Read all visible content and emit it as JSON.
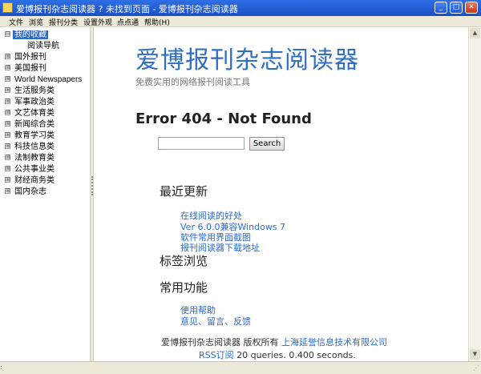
{
  "window": {
    "title": "爱博报刊杂志阅读器 ? 未找到页面 - 爱博报刊杂志阅读器",
    "buttons": {
      "minimize": "_",
      "maximize": "□",
      "close": "✕"
    }
  },
  "menu": [
    "文件",
    "浏览",
    "报刊分类",
    "设置外观",
    "点点通",
    "帮助(H)"
  ],
  "sidebar": {
    "items": [
      {
        "label": "我的收藏",
        "expander": "⊟",
        "selected": true,
        "children": [
          "阅读导航"
        ]
      },
      {
        "label": "国外报刊",
        "expander": "⊞"
      },
      {
        "label": "美国报刊",
        "expander": "⊞"
      },
      {
        "label": "World Newspapers",
        "expander": "⊞"
      },
      {
        "label": "生活服务类",
        "expander": "⊞"
      },
      {
        "label": "军事政治类",
        "expander": "⊞"
      },
      {
        "label": "文艺体育类",
        "expander": "⊞"
      },
      {
        "label": "新闻综合类",
        "expander": "⊞"
      },
      {
        "label": "教育学习类",
        "expander": "⊞"
      },
      {
        "label": "科技信息类",
        "expander": "⊞"
      },
      {
        "label": "法制教育类",
        "expander": "⊞"
      },
      {
        "label": "公共事业类",
        "expander": "⊞"
      },
      {
        "label": "财经商务类",
        "expander": "⊞"
      },
      {
        "label": "国内杂志",
        "expander": "⊞"
      }
    ]
  },
  "page": {
    "site_title": "爱博报刊杂志阅读器",
    "site_subtitle": "免费实用的网络报刊阅读工具",
    "error": "Error 404 - Not Found",
    "search": {
      "value": "",
      "button": "Search"
    },
    "sections": {
      "recent": {
        "heading": "最近更新",
        "links": [
          "在线阅读的好处",
          "Ver 6.0.0兼容Windows 7",
          "软件常用界面截图",
          "报刊阅读器下载地址"
        ]
      },
      "tags": {
        "heading": "标签浏览"
      },
      "common": {
        "heading": "常用功能",
        "links": [
          "使用帮助",
          "意见、留言、反馈"
        ]
      }
    },
    "footer": {
      "text": "爱博报刊杂志阅读器 版权所有",
      "company_link": "上海延誉信息技术有限公司",
      "rss_link": "RSS订阅",
      "stats": "20 queries. 0.400 seconds."
    }
  },
  "status": {
    "corner": ":",
    "grip": "⋰"
  }
}
